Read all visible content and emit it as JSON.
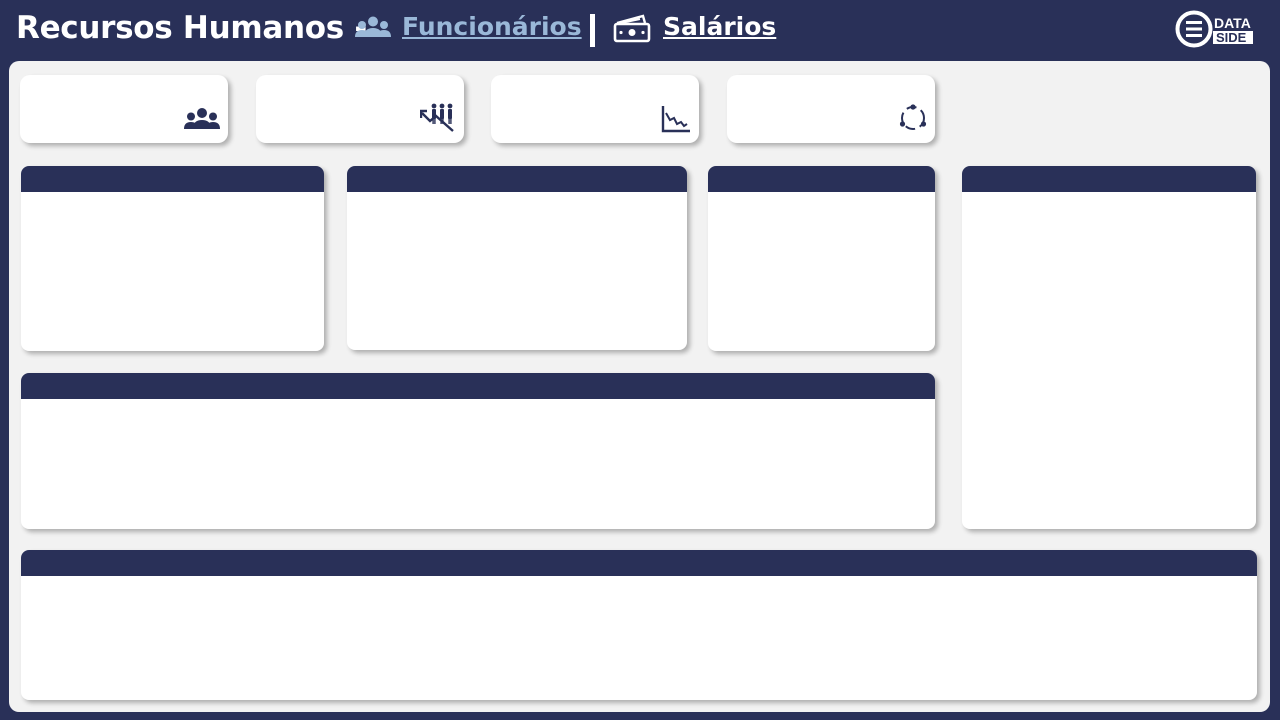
{
  "header": {
    "title": "Recursos Humanos -",
    "nav": {
      "funcionarios": "Funcionários",
      "salarios": "Salários"
    },
    "logo": {
      "line1": "DATA",
      "line2": "SIDE"
    }
  },
  "kpis": [
    {
      "icon": "people-group-icon"
    },
    {
      "icon": "people-decline-icon"
    },
    {
      "icon": "line-chart-down-icon"
    },
    {
      "icon": "turnover-cycle-icon"
    }
  ],
  "panels": [
    {
      "title": ""
    },
    {
      "title": ""
    },
    {
      "title": ""
    },
    {
      "title": ""
    },
    {
      "title": ""
    },
    {
      "title": ""
    }
  ],
  "colors": {
    "navy": "#293058",
    "active_nav": "#9ab8d8",
    "canvas": "#f2f2f2",
    "card": "#ffffff"
  }
}
